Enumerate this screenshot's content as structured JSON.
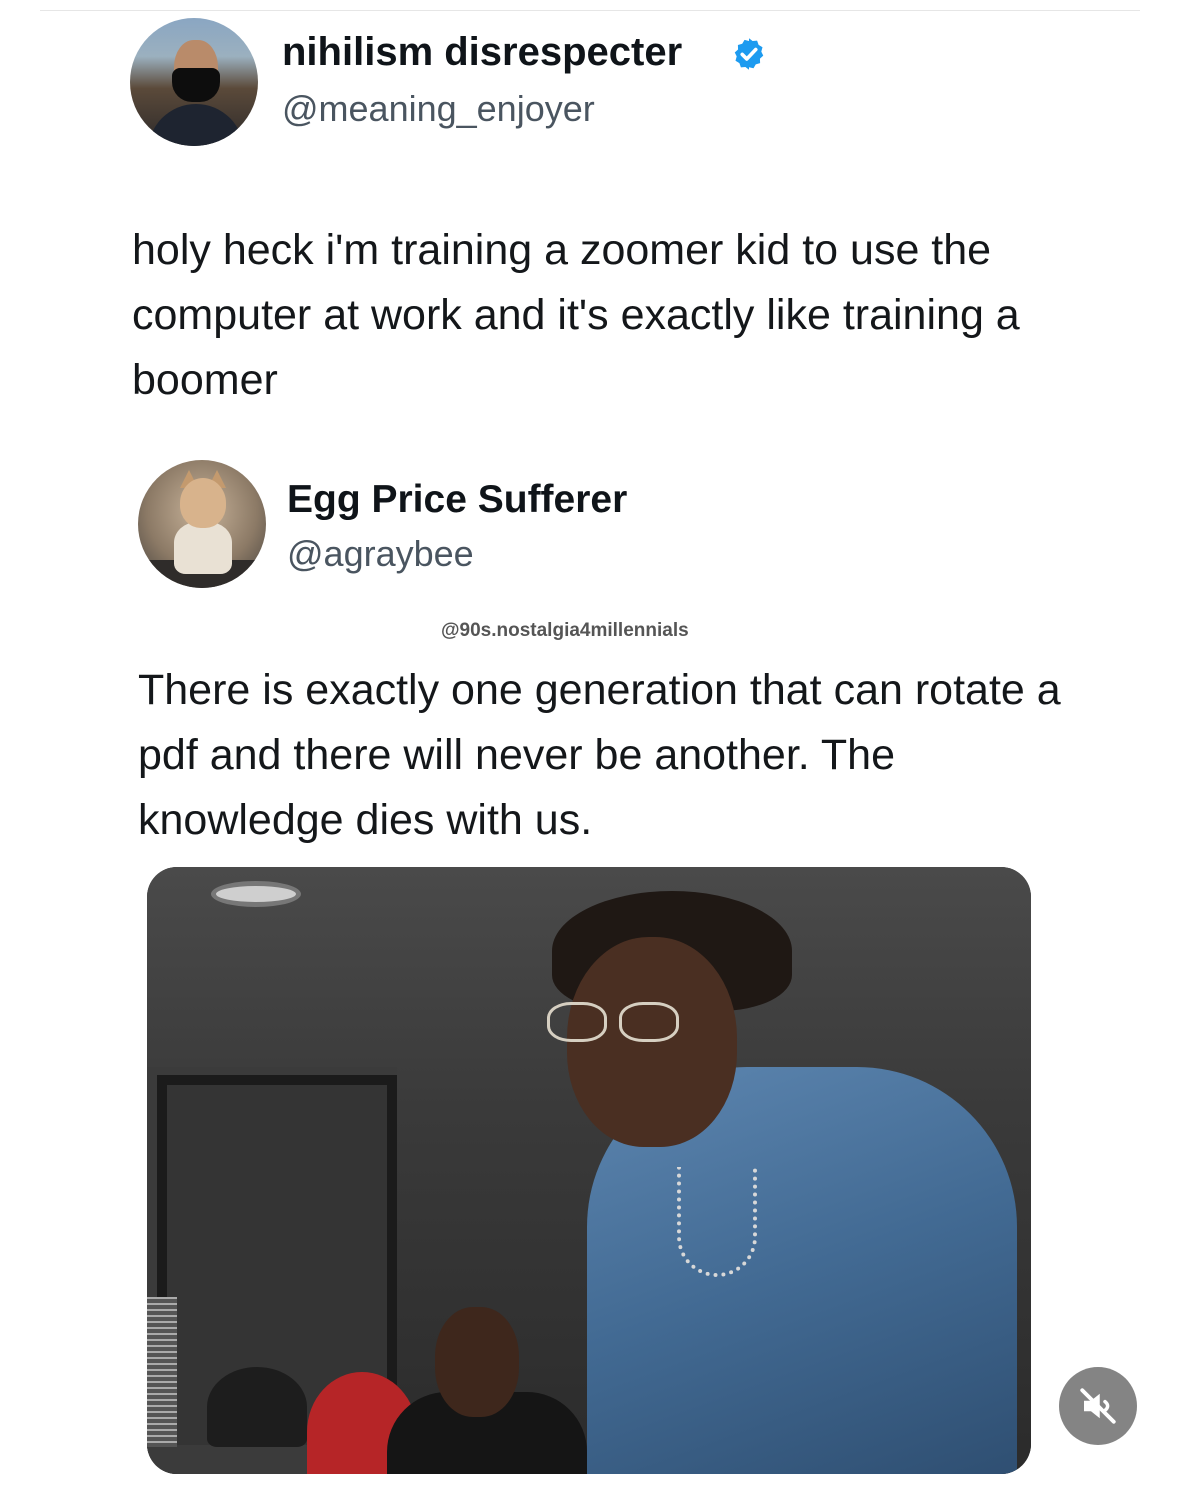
{
  "tweet_1": {
    "display_name": "nihilism disrespecter",
    "handle": "@meaning_enjoyer",
    "verified": true,
    "text": "holy heck i'm training a zoomer kid to use the computer at work and it's exactly like training a boomer"
  },
  "tweet_2": {
    "display_name": "Egg Price Sufferer",
    "handle": "@agraybee",
    "text": "There is exactly one generation that can rotate a pdf and there will never be another. The knowledge dies with us."
  },
  "watermark": "@90s.nostalgia4millennials",
  "colors": {
    "verified_badge": "#1d9bf0",
    "text": "#14171a",
    "handle": "#4a5560"
  },
  "icons": {
    "verified": "verified-badge-icon",
    "mute": "muted-speaker-icon"
  }
}
